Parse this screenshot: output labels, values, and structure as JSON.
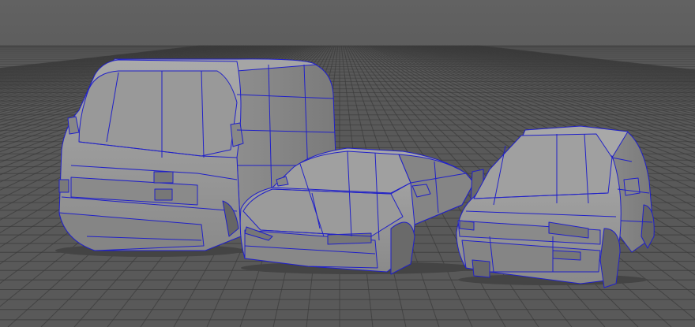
{
  "viewport": {
    "background_top": "#5f5f5f",
    "background_floor": "#595959",
    "grid_color": "#3b3b3b",
    "grid_color_bold": "#2f2f2f",
    "wire_color": "#1f1fd0",
    "mesh_fill": "#8c8c8c",
    "mesh_fill_light": "#a7a7a7",
    "mesh_fill_dark": "#6f6f6f"
  },
  "objects": [
    {
      "id": "van",
      "type": "low-poly-van-mesh"
    },
    {
      "id": "sedan",
      "type": "low-poly-sedan-mesh"
    },
    {
      "id": "hatchback",
      "type": "low-poly-hatchback-mesh"
    }
  ]
}
